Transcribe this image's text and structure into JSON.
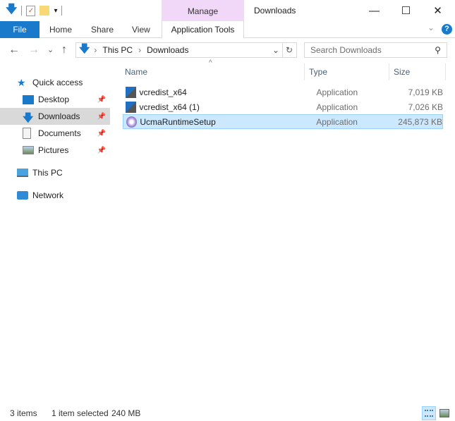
{
  "window": {
    "title": "Downloads",
    "minimize": "—",
    "maximize": "☐",
    "close": "✕"
  },
  "ribbon": {
    "file": "File",
    "tabs": [
      "Home",
      "Share",
      "View"
    ],
    "context_group": "Manage",
    "context_tab": "Application Tools",
    "expand": "⌄",
    "help": "?"
  },
  "nav": {
    "back": "←",
    "forward": "→",
    "recent": "⌄",
    "up": "↑"
  },
  "address": {
    "crumbs": [
      "This PC",
      "Downloads"
    ],
    "sep": "›",
    "dropdown": "⌄",
    "refresh": "↻"
  },
  "search": {
    "placeholder": "Search Downloads",
    "icon": "⚲"
  },
  "sidebar": {
    "items": [
      {
        "label": "Quick access"
      },
      {
        "label": "Desktop",
        "pinned": true
      },
      {
        "label": "Downloads",
        "pinned": true,
        "selected": true
      },
      {
        "label": "Documents",
        "pinned": true
      },
      {
        "label": "Pictures",
        "pinned": true
      },
      {
        "label": "This PC"
      },
      {
        "label": "Network"
      }
    ]
  },
  "list": {
    "columns": [
      "Name",
      "Type",
      "Size"
    ],
    "sort_indicator": "^",
    "rows": [
      {
        "name": "vcredist_x64",
        "type": "Application",
        "size": "7,019 KB"
      },
      {
        "name": "vcredist_x64 (1)",
        "type": "Application",
        "size": "7,026 KB"
      },
      {
        "name": "UcmaRuntimeSetup",
        "type": "Application",
        "size": "245,873 KB",
        "selected": true
      }
    ]
  },
  "status": {
    "count": "3 items",
    "selection": "1 item selected",
    "size": "240 MB"
  }
}
